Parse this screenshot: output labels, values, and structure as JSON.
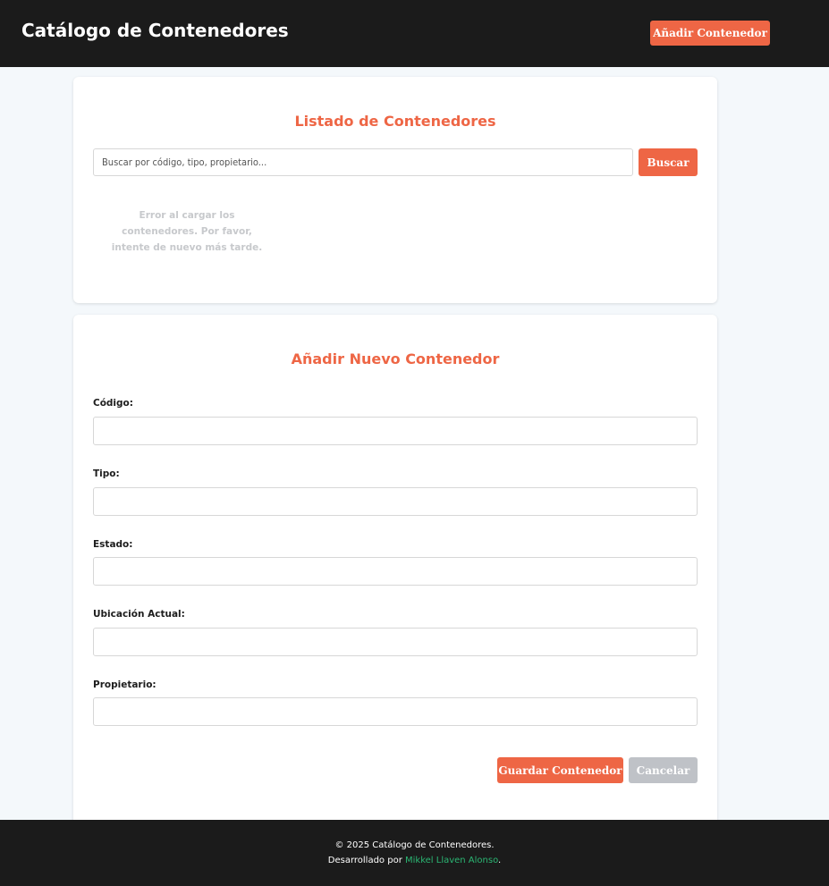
{
  "header": {
    "title": "Catálogo de Contenedores",
    "add_button_label": "Añadir Contenedor"
  },
  "list_section": {
    "title": "Listado de Contenedores",
    "search_placeholder": "Buscar por código, tipo, propietario...",
    "search_value": "",
    "search_button_label": "Buscar",
    "error_message": "Error al cargar los contenedores. Por favor, intente de nuevo más tarde."
  },
  "form_section": {
    "title": "Añadir Nuevo Contenedor",
    "fields": [
      {
        "label": "Código:",
        "value": ""
      },
      {
        "label": "Tipo:",
        "value": ""
      },
      {
        "label": "Estado:",
        "value": ""
      },
      {
        "label": "Ubicación Actual:",
        "value": ""
      },
      {
        "label": "Propietario:",
        "value": ""
      }
    ],
    "save_button_label": "Guardar Contenedor",
    "cancel_button_label": "Cancelar"
  },
  "footer": {
    "copyright": "© 2025 Catálogo de Contenedores.",
    "developed_by_prefix": "Desarrollado por",
    "developer_name": "Mikkel Llaven Alonso",
    "developed_by_suffix": "."
  },
  "colors": {
    "accent": "#ee6645",
    "header_bg": "#1b1b1b",
    "page_bg": "#f4f8fb",
    "disabled_button": "#bfc2c7",
    "link": "#2bb673",
    "error_text": "#c7c9cc"
  }
}
